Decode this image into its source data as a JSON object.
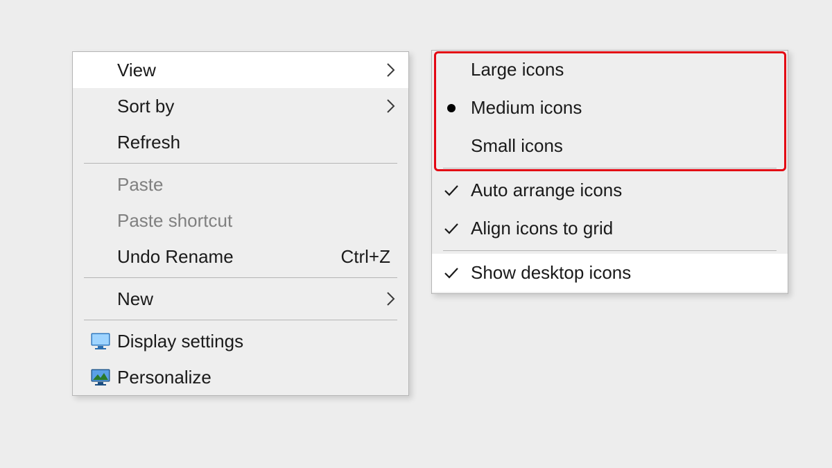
{
  "context_menu": {
    "items": {
      "view": {
        "label": "View"
      },
      "sort_by": {
        "label": "Sort by"
      },
      "refresh": {
        "label": "Refresh"
      },
      "paste": {
        "label": "Paste"
      },
      "paste_shortcut": {
        "label": "Paste shortcut"
      },
      "undo_rename": {
        "label": "Undo Rename",
        "accel": "Ctrl+Z"
      },
      "new": {
        "label": "New"
      },
      "display_settings": {
        "label": "Display settings"
      },
      "personalize": {
        "label": "Personalize"
      }
    }
  },
  "submenu": {
    "large_icons": {
      "label": "Large icons"
    },
    "medium_icons": {
      "label": "Medium icons"
    },
    "small_icons": {
      "label": "Small icons"
    },
    "auto_arrange": {
      "label": "Auto arrange icons"
    },
    "align_grid": {
      "label": "Align icons to grid"
    },
    "show_desktop": {
      "label": "Show desktop icons"
    }
  },
  "highlight_color": "#e30613"
}
